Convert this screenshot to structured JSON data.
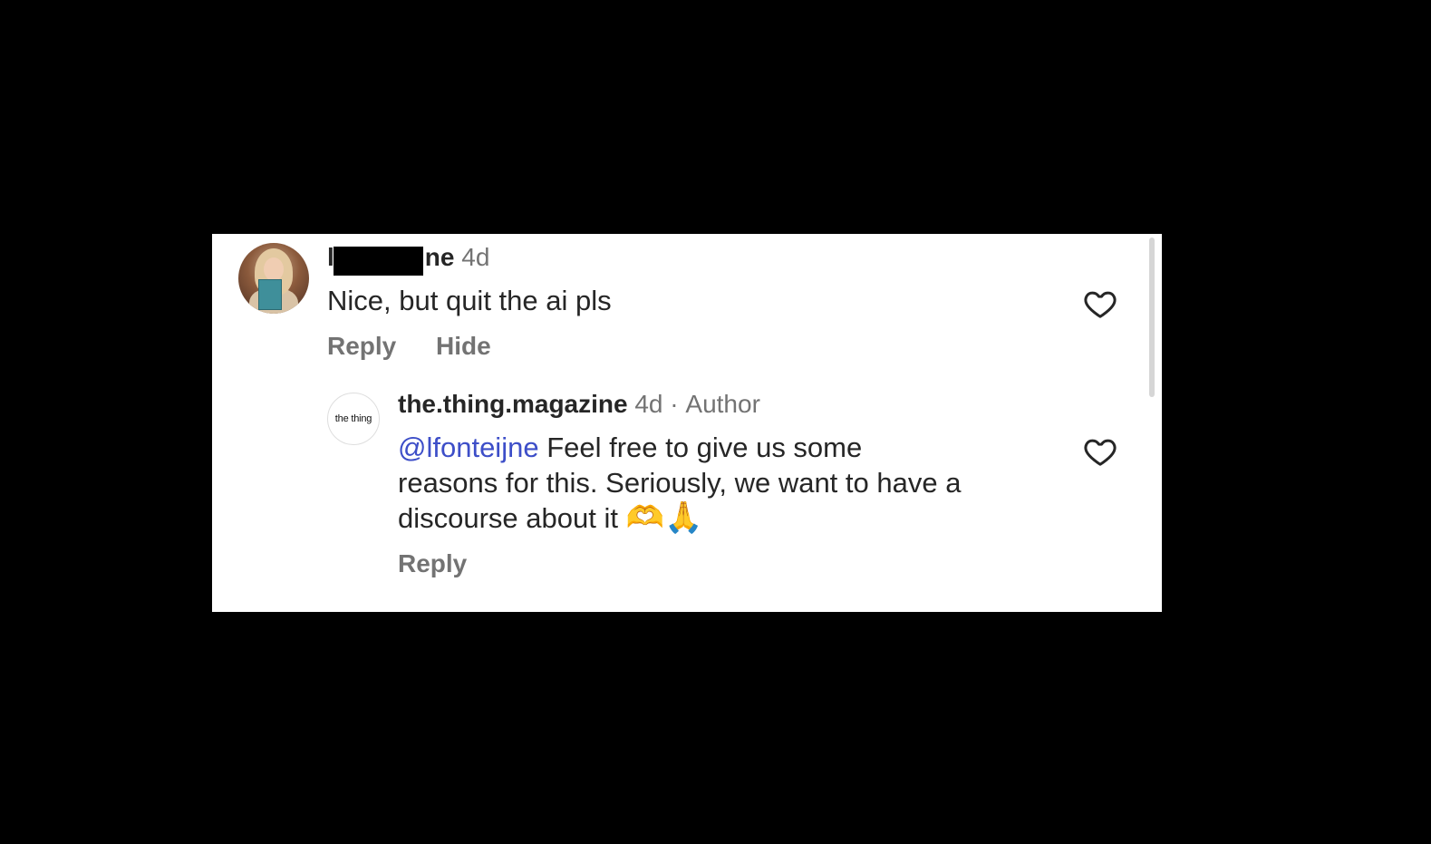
{
  "comments": [
    {
      "username": "lfonteijne",
      "visible_username_parts": {
        "start": "l",
        "end": "ne"
      },
      "time": "4d",
      "text": "Nice, but quit the ai pls",
      "actions": {
        "reply": "Reply",
        "hide": "Hide"
      },
      "like_icon": "heart-outline-icon"
    }
  ],
  "reply": {
    "username": "the.thing.magazine",
    "time": "4d",
    "separator": "·",
    "badge": "Author",
    "avatar_text": "the thing",
    "mention": "@lfonteijne",
    "text_line1": "Feel free to give us some",
    "text_line2": "reasons for this. Seriously, we want to have a",
    "text_line3": "discourse about it",
    "emojis": [
      "🫶",
      "🙏"
    ],
    "actions": {
      "reply": "Reply"
    },
    "like_icon": "heart-outline-icon"
  },
  "colors": {
    "background": "#000000",
    "panel": "#ffffff",
    "text": "#262626",
    "muted": "#737373",
    "mention": "#3d4ec8"
  }
}
